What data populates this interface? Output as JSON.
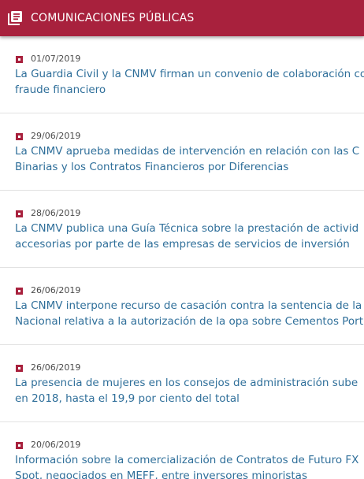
{
  "header": {
    "title": "COMUNICACIONES PÚBLICAS",
    "icon": "news-list-icon",
    "background_color": "#a8213d"
  },
  "items": [
    {
      "date": "01/07/2019",
      "title_lines": [
        "La Guardia Civil y la CNMV firman un convenio de colaboración co",
        "fraude financiero"
      ]
    },
    {
      "date": "29/06/2019",
      "title_lines": [
        "La CNMV aprueba medidas de intervención en relación con las C",
        "Binarias y los Contratos Financieros por Diferencias"
      ]
    },
    {
      "date": "28/06/2019",
      "title_lines": [
        "La CNMV publica una Guía Técnica sobre la prestación de activid",
        "accesorias por parte de las empresas de servicios de inversión"
      ]
    },
    {
      "date": "26/06/2019",
      "title_lines": [
        "La CNMV interpone recurso de casación contra la sentencia de la",
        "Nacional relativa a la autorización de la opa sobre Cementos Port"
      ]
    },
    {
      "date": "26/06/2019",
      "title_lines": [
        "La presencia de mujeres en los consejos de administración sube",
        "en 2018, hasta el 19,9 por ciento del total"
      ]
    },
    {
      "date": "20/06/2019",
      "title_lines": [
        "Información sobre la comercialización de Contratos de Futuro FX",
        "Spot, negociados en MEFF, entre inversores minoristas"
      ]
    }
  ],
  "colors": {
    "accent": "#a8213d",
    "link_text": "#2f6f9a",
    "date_text": "#4a4a4a",
    "divider": "#e2e2e2"
  }
}
